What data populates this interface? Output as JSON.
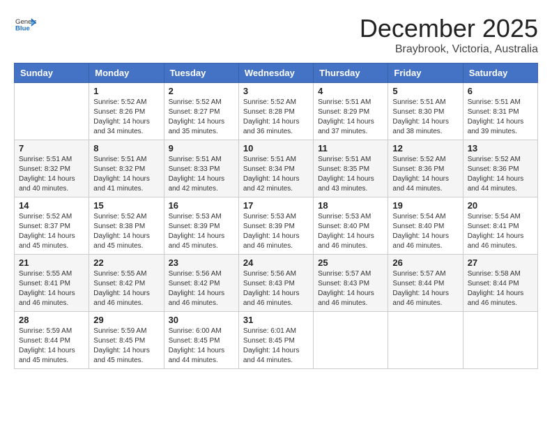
{
  "header": {
    "logo_line1": "General",
    "logo_line2": "Blue",
    "month": "December 2025",
    "location": "Braybrook, Victoria, Australia"
  },
  "weekdays": [
    "Sunday",
    "Monday",
    "Tuesday",
    "Wednesday",
    "Thursday",
    "Friday",
    "Saturday"
  ],
  "weeks": [
    [
      {
        "day": "",
        "info": ""
      },
      {
        "day": "1",
        "info": "Sunrise: 5:52 AM\nSunset: 8:26 PM\nDaylight: 14 hours\nand 34 minutes."
      },
      {
        "day": "2",
        "info": "Sunrise: 5:52 AM\nSunset: 8:27 PM\nDaylight: 14 hours\nand 35 minutes."
      },
      {
        "day": "3",
        "info": "Sunrise: 5:52 AM\nSunset: 8:28 PM\nDaylight: 14 hours\nand 36 minutes."
      },
      {
        "day": "4",
        "info": "Sunrise: 5:51 AM\nSunset: 8:29 PM\nDaylight: 14 hours\nand 37 minutes."
      },
      {
        "day": "5",
        "info": "Sunrise: 5:51 AM\nSunset: 8:30 PM\nDaylight: 14 hours\nand 38 minutes."
      },
      {
        "day": "6",
        "info": "Sunrise: 5:51 AM\nSunset: 8:31 PM\nDaylight: 14 hours\nand 39 minutes."
      }
    ],
    [
      {
        "day": "7",
        "info": "Sunrise: 5:51 AM\nSunset: 8:32 PM\nDaylight: 14 hours\nand 40 minutes."
      },
      {
        "day": "8",
        "info": "Sunrise: 5:51 AM\nSunset: 8:32 PM\nDaylight: 14 hours\nand 41 minutes."
      },
      {
        "day": "9",
        "info": "Sunrise: 5:51 AM\nSunset: 8:33 PM\nDaylight: 14 hours\nand 42 minutes."
      },
      {
        "day": "10",
        "info": "Sunrise: 5:51 AM\nSunset: 8:34 PM\nDaylight: 14 hours\nand 42 minutes."
      },
      {
        "day": "11",
        "info": "Sunrise: 5:51 AM\nSunset: 8:35 PM\nDaylight: 14 hours\nand 43 minutes."
      },
      {
        "day": "12",
        "info": "Sunrise: 5:52 AM\nSunset: 8:36 PM\nDaylight: 14 hours\nand 44 minutes."
      },
      {
        "day": "13",
        "info": "Sunrise: 5:52 AM\nSunset: 8:36 PM\nDaylight: 14 hours\nand 44 minutes."
      }
    ],
    [
      {
        "day": "14",
        "info": "Sunrise: 5:52 AM\nSunset: 8:37 PM\nDaylight: 14 hours\nand 45 minutes."
      },
      {
        "day": "15",
        "info": "Sunrise: 5:52 AM\nSunset: 8:38 PM\nDaylight: 14 hours\nand 45 minutes."
      },
      {
        "day": "16",
        "info": "Sunrise: 5:53 AM\nSunset: 8:39 PM\nDaylight: 14 hours\nand 45 minutes."
      },
      {
        "day": "17",
        "info": "Sunrise: 5:53 AM\nSunset: 8:39 PM\nDaylight: 14 hours\nand 46 minutes."
      },
      {
        "day": "18",
        "info": "Sunrise: 5:53 AM\nSunset: 8:40 PM\nDaylight: 14 hours\nand 46 minutes."
      },
      {
        "day": "19",
        "info": "Sunrise: 5:54 AM\nSunset: 8:40 PM\nDaylight: 14 hours\nand 46 minutes."
      },
      {
        "day": "20",
        "info": "Sunrise: 5:54 AM\nSunset: 8:41 PM\nDaylight: 14 hours\nand 46 minutes."
      }
    ],
    [
      {
        "day": "21",
        "info": "Sunrise: 5:55 AM\nSunset: 8:41 PM\nDaylight: 14 hours\nand 46 minutes."
      },
      {
        "day": "22",
        "info": "Sunrise: 5:55 AM\nSunset: 8:42 PM\nDaylight: 14 hours\nand 46 minutes."
      },
      {
        "day": "23",
        "info": "Sunrise: 5:56 AM\nSunset: 8:42 PM\nDaylight: 14 hours\nand 46 minutes."
      },
      {
        "day": "24",
        "info": "Sunrise: 5:56 AM\nSunset: 8:43 PM\nDaylight: 14 hours\nand 46 minutes."
      },
      {
        "day": "25",
        "info": "Sunrise: 5:57 AM\nSunset: 8:43 PM\nDaylight: 14 hours\nand 46 minutes."
      },
      {
        "day": "26",
        "info": "Sunrise: 5:57 AM\nSunset: 8:44 PM\nDaylight: 14 hours\nand 46 minutes."
      },
      {
        "day": "27",
        "info": "Sunrise: 5:58 AM\nSunset: 8:44 PM\nDaylight: 14 hours\nand 46 minutes."
      }
    ],
    [
      {
        "day": "28",
        "info": "Sunrise: 5:59 AM\nSunset: 8:44 PM\nDaylight: 14 hours\nand 45 minutes."
      },
      {
        "day": "29",
        "info": "Sunrise: 5:59 AM\nSunset: 8:45 PM\nDaylight: 14 hours\nand 45 minutes."
      },
      {
        "day": "30",
        "info": "Sunrise: 6:00 AM\nSunset: 8:45 PM\nDaylight: 14 hours\nand 44 minutes."
      },
      {
        "day": "31",
        "info": "Sunrise: 6:01 AM\nSunset: 8:45 PM\nDaylight: 14 hours\nand 44 minutes."
      },
      {
        "day": "",
        "info": ""
      },
      {
        "day": "",
        "info": ""
      },
      {
        "day": "",
        "info": ""
      }
    ]
  ]
}
